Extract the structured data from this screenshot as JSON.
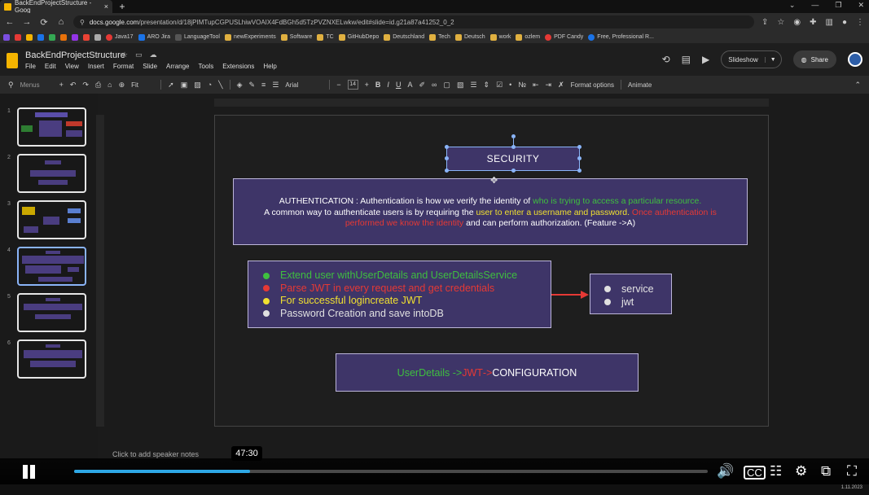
{
  "browser": {
    "tab_title": "BackEndProjectStructure - Goog",
    "tab_close": "×",
    "new_tab": "+",
    "url_domain": "docs.google.com",
    "url_path": "/presentation/d/18jPIMTupCGPUSLhiwVOAIX4FdBGh5d5TzPVZNXELwkw/edit#slide=id.g21a87a41252_0_2",
    "bookmarks": [
      "Java17",
      "ARO Jira",
      "LanguageTool",
      "newExperiments",
      "Software",
      "TC",
      "GitHubDepo",
      "Deutschland",
      "Tech",
      "Deutsch",
      "work",
      "ozlem",
      "PDF Candy",
      "Free, Professional R..."
    ]
  },
  "app": {
    "doc_title": "BackEndProjectStructure",
    "menu": [
      "File",
      "Edit",
      "View",
      "Insert",
      "Format",
      "Slide",
      "Arrange",
      "Tools",
      "Extensions",
      "Help"
    ],
    "slideshow_label": "Slideshow",
    "share_label": "Share",
    "toolbar": {
      "menus_label": "Menus",
      "zoom": "Fit",
      "font": "Arial",
      "font_size": "14",
      "format_options": "Format options",
      "animate": "Animate"
    }
  },
  "filmstrip": {
    "numbers": [
      "1",
      "2",
      "3",
      "4",
      "5",
      "6"
    ]
  },
  "slide": {
    "title": "SECURITY",
    "auth": {
      "l1a": "AUTHENTICATION : Authentication is how we verify the identity of ",
      "l1b": "who is trying to access  a particular resource.",
      "l2a": "A common way to authenticate users  is by requiring the ",
      "l2b": "user to enter a username and password.",
      "l2c": " Once authentication is",
      "l3a": "performed we know the identity",
      "l3b": " and can perform authorization. (Feature ->A)"
    },
    "features": [
      {
        "text": "Extend user withUserDetails and UserDetailsService",
        "color": "#3fbf3f"
      },
      {
        "text": "Parse JWT  in every request and get credentials",
        "color": "#e53935"
      },
      {
        "text": "For successful  logincreate JWT",
        "color": "#f0e030"
      },
      {
        "text": "Password  Creation and save  intoDB",
        "color": "#e0e0e0"
      }
    ],
    "services": [
      "service",
      "jwt"
    ],
    "config": {
      "part1": "UserDetails  ->",
      "part2": "JWT",
      "part3": "  ->",
      "part4": " CONFIGURATION"
    },
    "speaker_notes_placeholder": "Click to add speaker notes"
  },
  "player": {
    "time_tooltip": "47:30",
    "progress_fraction": 0.277,
    "date": "1.11.2023"
  },
  "colors": {
    "box_fill": "#3e3568",
    "accent_blue": "#8ab4f8",
    "progress": "#2ea8e6"
  }
}
